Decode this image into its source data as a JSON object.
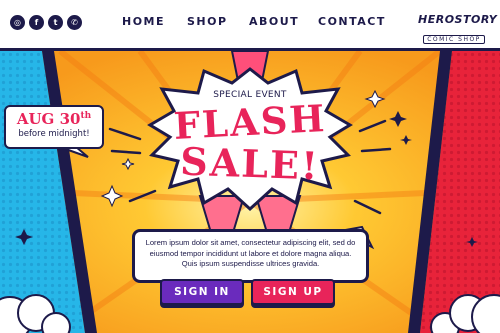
{
  "socials": [
    {
      "name": "instagram-icon",
      "glyph": "◎"
    },
    {
      "name": "facebook-icon",
      "glyph": "f"
    },
    {
      "name": "twitter-icon",
      "glyph": "t"
    },
    {
      "name": "whatsapp-icon",
      "glyph": "✆"
    }
  ],
  "nav": {
    "home": "HOME",
    "shop": "SHOP",
    "about": "ABOUT",
    "contact": "CONTACT"
  },
  "brand": {
    "name": "HEROSTORY",
    "tagline": "COMIC SHOP"
  },
  "promo": {
    "date": "AUG 30",
    "date_suffix": "th",
    "deadline": "before midnight!",
    "label": "SPECIAL EVENT",
    "headline_1": "FLASH",
    "headline_2": "SALE!",
    "body": "Lorem ipsum dolor sit amet, consectetur adipiscing elit, sed do eiusmod tempor incididunt ut labore et dolore magna aliqua. Quis ipsum suspendisse ultrices gravida."
  },
  "buttons": {
    "sign_in": "SIGN IN",
    "sign_up": "SIGN UP"
  },
  "colors": {
    "navy": "#1d1a4a",
    "pink": "#e8245a",
    "purple": "#6a2bbd",
    "orange": "#f79a1c",
    "yellow": "#ffc933",
    "cyan": "#26b6e8",
    "red": "#e8233a"
  }
}
